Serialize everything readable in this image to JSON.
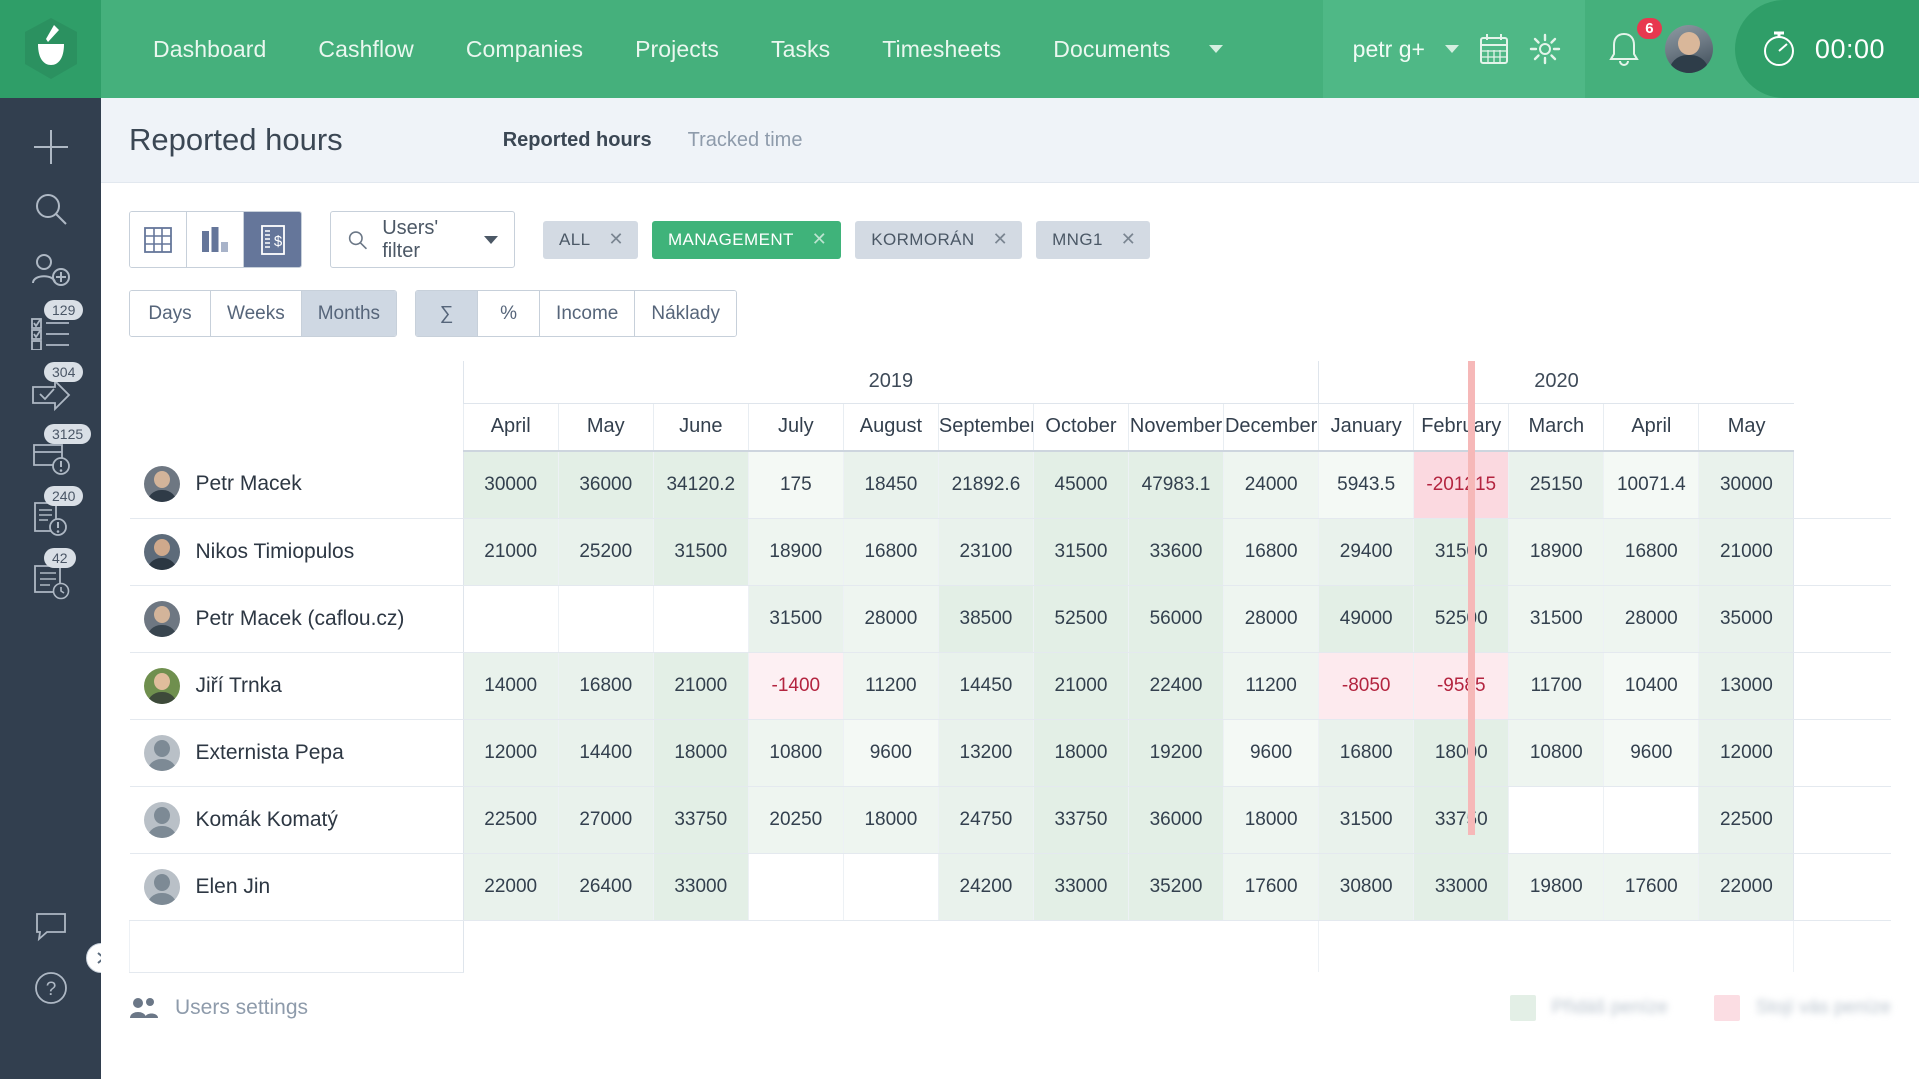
{
  "topnav": {
    "logo_icon": "caflou-cup-logo",
    "items": [
      {
        "label": "Dashboard"
      },
      {
        "label": "Cashflow"
      },
      {
        "label": "Companies"
      },
      {
        "label": "Projects"
      },
      {
        "label": "Tasks"
      },
      {
        "label": "Timesheets"
      },
      {
        "label": "Documents"
      }
    ],
    "more_icon": "chevron-down-icon",
    "user_name": "petr g+",
    "user_caret_icon": "chevron-down-icon",
    "calendar_icon": "calendar-icon",
    "settings_icon": "gear-icon",
    "bell_icon": "bell-icon",
    "notification_count": "6",
    "avatar_icon": "user-avatar",
    "stopwatch_icon": "stopwatch-icon",
    "timer": "00:00"
  },
  "rail": {
    "items": [
      {
        "icon": "plus-icon",
        "badge": ""
      },
      {
        "icon": "search-icon",
        "badge": ""
      },
      {
        "icon": "add-user-icon",
        "badge": ""
      },
      {
        "icon": "checklist-icon",
        "badge": "129"
      },
      {
        "icon": "arrow-check-icon",
        "badge": "304"
      },
      {
        "icon": "invoice-alert-icon",
        "badge": "3125"
      },
      {
        "icon": "document-alert-icon",
        "badge": "240"
      },
      {
        "icon": "list-clock-icon",
        "badge": "42"
      }
    ],
    "chat_icon": "chat-icon",
    "help_icon": "question-mark-icon",
    "collapse_icon": "chevron-right-icon"
  },
  "page": {
    "title": "Reported hours",
    "tabs": [
      {
        "label": "Reported hours",
        "active": true
      },
      {
        "label": "Tracked time",
        "active": false
      }
    ]
  },
  "toolbar": {
    "views": [
      {
        "icon": "table-view-icon",
        "active": false
      },
      {
        "icon": "chart-view-icon",
        "active": false
      },
      {
        "icon": "invoice-view-icon",
        "active": true
      }
    ],
    "filter": {
      "icon": "search-icon",
      "label": "Users' filter",
      "caret_icon": "caret-down-icon"
    },
    "chips": [
      {
        "label": "ALL",
        "active": false,
        "close_icon": "close-icon"
      },
      {
        "label": "MANAGEMENT",
        "active": true,
        "close_icon": "close-icon"
      },
      {
        "label": "KORMORÁN",
        "active": false,
        "close_icon": "close-icon"
      },
      {
        "label": "MNG1",
        "active": false,
        "close_icon": "close-icon"
      }
    ]
  },
  "segments": {
    "period": [
      {
        "label": "Days",
        "active": false
      },
      {
        "label": "Weeks",
        "active": false
      },
      {
        "label": "Months",
        "active": true
      }
    ],
    "mode": [
      {
        "label": "∑",
        "active": true
      },
      {
        "label": "%",
        "active": false
      },
      {
        "label": "Income",
        "active": false
      },
      {
        "label": "Náklady",
        "active": false
      }
    ]
  },
  "table": {
    "years": [
      {
        "label": "2019",
        "span": 9
      },
      {
        "label": "2020",
        "span": 5
      }
    ],
    "months": [
      "April",
      "May",
      "June",
      "July",
      "August",
      "September",
      "October",
      "November",
      "December",
      "January",
      "February",
      "March",
      "April",
      "May"
    ],
    "rows": [
      {
        "name": "Petr Macek",
        "avatar": "user-avatar-photo",
        "values": [
          "30000",
          "36000",
          "34120.2",
          "175",
          "18450",
          "21892.6",
          "45000",
          "47983.1",
          "24000",
          "5943.5",
          "-201215",
          "25150",
          "10071.4",
          "30000"
        ],
        "shades": [
          "g1",
          "g1",
          "g1",
          "g4",
          "g2",
          "g2",
          "g1",
          "g1",
          "g3",
          "g4",
          "r1",
          "g2",
          "g4",
          "g2"
        ]
      },
      {
        "name": "Nikos Timiopulos",
        "avatar": "user-avatar-photo",
        "values": [
          "21000",
          "25200",
          "31500",
          "18900",
          "16800",
          "23100",
          "31500",
          "33600",
          "16800",
          "29400",
          "31500",
          "18900",
          "16800",
          "21000"
        ],
        "shades": [
          "g2",
          "g2",
          "g1",
          "g3",
          "g3",
          "g2",
          "g1",
          "g1",
          "g3",
          "g2",
          "g1",
          "g3",
          "g3",
          "g2"
        ]
      },
      {
        "name": "Petr Macek (caflou.cz)",
        "avatar": "user-avatar-photo",
        "values": [
          "",
          "",
          "",
          "31500",
          "28000",
          "38500",
          "52500",
          "56000",
          "28000",
          "49000",
          "52500",
          "31500",
          "28000",
          "35000"
        ],
        "shades": [
          "g0",
          "g0",
          "g0",
          "g2",
          "g3",
          "g1",
          "g1",
          "g1",
          "g3",
          "g1",
          "g1",
          "g3",
          "g3",
          "g2"
        ]
      },
      {
        "name": "Jiří Trnka",
        "avatar": "user-avatar-photo",
        "values": [
          "14000",
          "16800",
          "21000",
          "-1400",
          "11200",
          "14450",
          "21000",
          "22400",
          "11200",
          "-8050",
          "-9585",
          "11700",
          "10400",
          "13000"
        ],
        "shades": [
          "g2",
          "g2",
          "g1",
          "r3",
          "g3",
          "g2",
          "g1",
          "g1",
          "g3",
          "r2",
          "r2",
          "g3",
          "g4",
          "g2"
        ]
      },
      {
        "name": "Externista Pepa",
        "avatar": "user-avatar-generic",
        "values": [
          "12000",
          "14400",
          "18000",
          "10800",
          "9600",
          "13200",
          "18000",
          "19200",
          "9600",
          "16800",
          "18000",
          "10800",
          "9600",
          "12000"
        ],
        "shades": [
          "g2",
          "g2",
          "g1",
          "g3",
          "g4",
          "g2",
          "g1",
          "g1",
          "g4",
          "g2",
          "g1",
          "g3",
          "g4",
          "g2"
        ]
      },
      {
        "name": "Komák Komatý",
        "avatar": "user-avatar-generic",
        "values": [
          "22500",
          "27000",
          "33750",
          "20250",
          "18000",
          "24750",
          "33750",
          "36000",
          "18000",
          "31500",
          "33750",
          "",
          "",
          "22500"
        ],
        "shades": [
          "g2",
          "g2",
          "g1",
          "g3",
          "g3",
          "g2",
          "g1",
          "g1",
          "g3",
          "g2",
          "g1",
          "g0",
          "g0",
          "g2"
        ]
      },
      {
        "name": "Elen Jin",
        "avatar": "user-avatar-generic",
        "values": [
          "22000",
          "26400",
          "33000",
          "",
          "",
          "24200",
          "33000",
          "35200",
          "17600",
          "30800",
          "33000",
          "19800",
          "17600",
          "22000"
        ],
        "shades": [
          "g2",
          "g2",
          "g1",
          "g0",
          "g0",
          "g2",
          "g1",
          "g1",
          "g3",
          "g2",
          "g1",
          "g3",
          "g3",
          "g2"
        ]
      }
    ]
  },
  "footer": {
    "users_settings_icon": "users-icon",
    "users_settings_label": "Users settings",
    "legend": [
      {
        "swatch": "green",
        "label": "Přidáš peníze"
      },
      {
        "swatch": "pink",
        "label": "Stojí vás peníze"
      }
    ]
  }
}
